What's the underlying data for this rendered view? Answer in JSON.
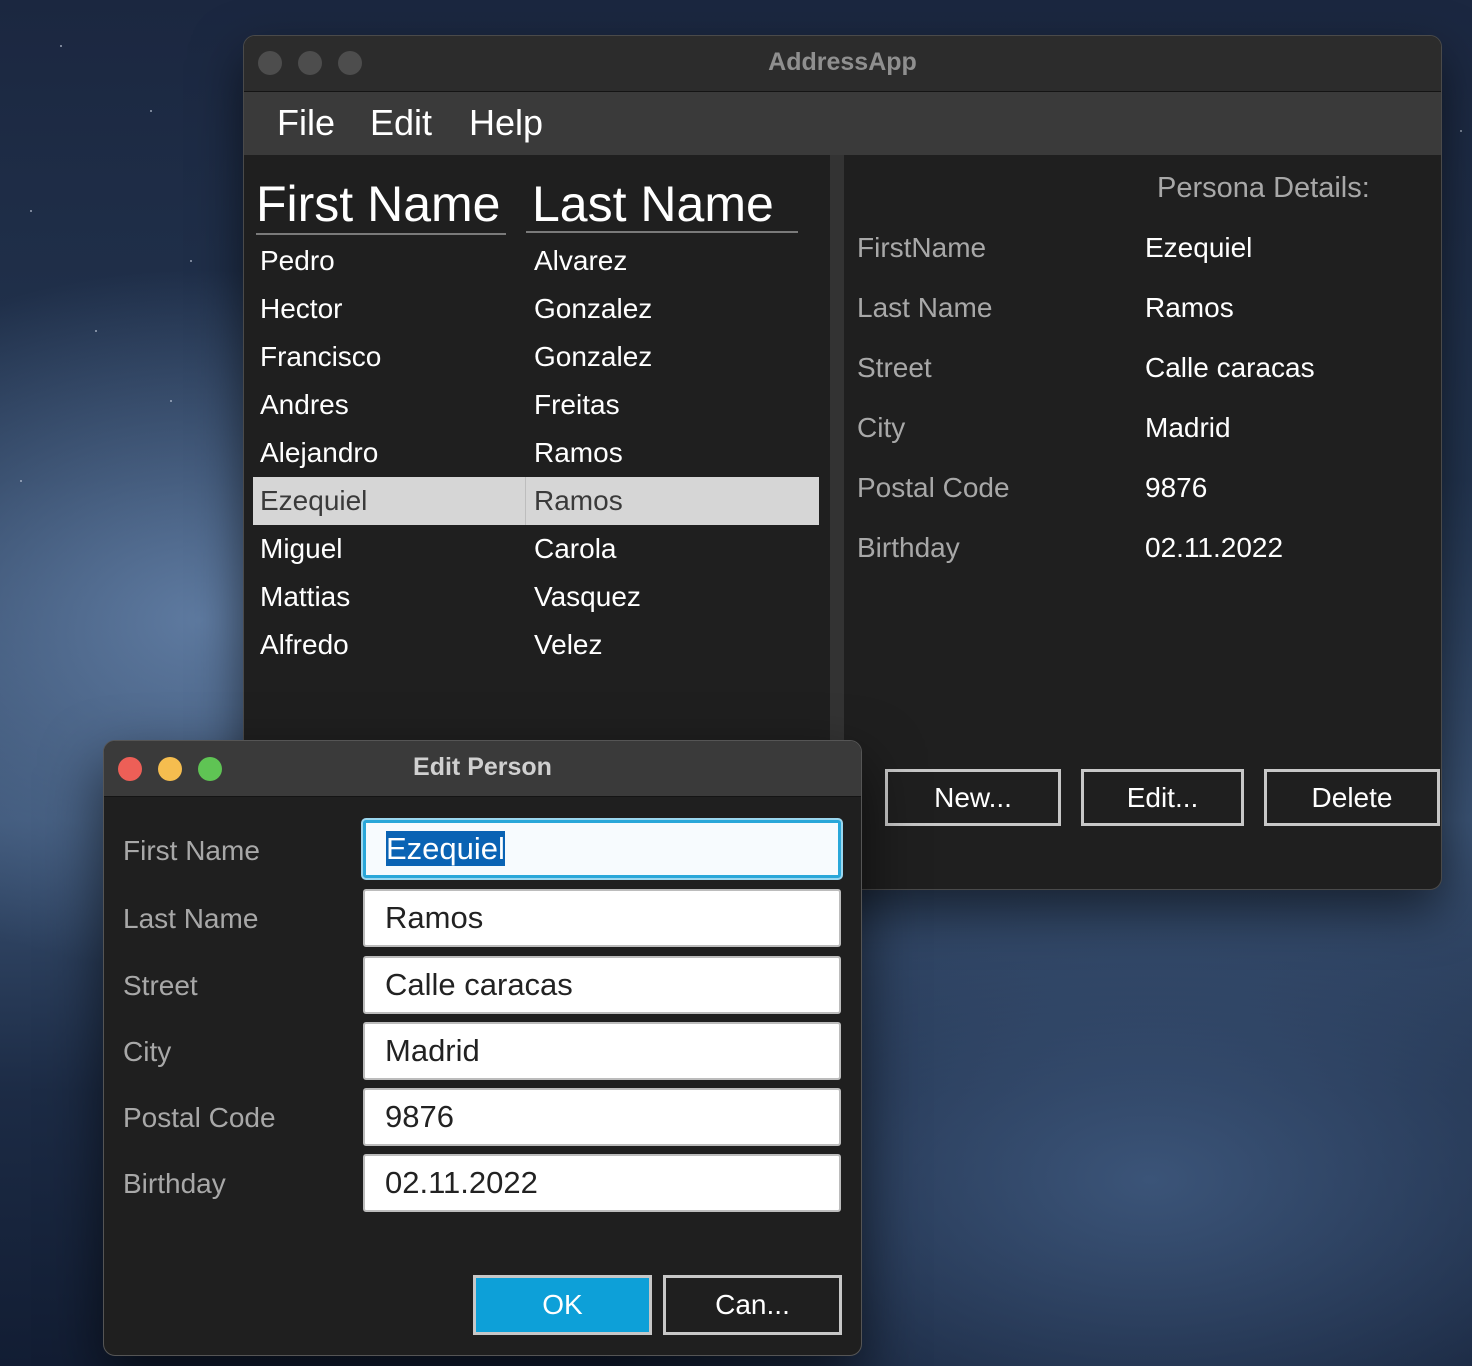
{
  "main_window": {
    "title": "AddressApp",
    "menu": [
      "File",
      "Edit",
      "Help"
    ],
    "table": {
      "columns": [
        "First Name",
        "Last Name"
      ],
      "rows": [
        [
          "Pedro",
          "Alvarez"
        ],
        [
          "Hector",
          "Gonzalez"
        ],
        [
          "Francisco",
          "Gonzalez"
        ],
        [
          "Andres",
          "Freitas"
        ],
        [
          "Alejandro",
          "Ramos"
        ],
        [
          "Ezequiel",
          "Ramos"
        ],
        [
          "Miguel",
          "Carola"
        ],
        [
          "Mattias",
          "Vasquez"
        ],
        [
          "Alfredo",
          "Velez"
        ]
      ],
      "selected_index": 5
    },
    "details": {
      "title": "Persona Details:",
      "fields": [
        {
          "label": "FirstName",
          "value": "Ezequiel"
        },
        {
          "label": "Last Name",
          "value": "Ramos"
        },
        {
          "label": "Street",
          "value": "Calle caracas"
        },
        {
          "label": "City",
          "value": "Madrid"
        },
        {
          "label": "Postal Code",
          "value": "9876"
        },
        {
          "label": "Birthday",
          "value": "02.11.2022"
        }
      ]
    },
    "buttons": {
      "new": "New...",
      "edit": "Edit...",
      "delete": "Delete"
    }
  },
  "dialog": {
    "title": "Edit Person",
    "fields": [
      {
        "label": "First Name",
        "value": "Ezequiel"
      },
      {
        "label": "Last Name",
        "value": "Ramos"
      },
      {
        "label": "Street",
        "value": "Calle caracas"
      },
      {
        "label": "City",
        "value": "Madrid"
      },
      {
        "label": "Postal Code",
        "value": "9876"
      },
      {
        "label": "Birthday",
        "value": "02.11.2022"
      }
    ],
    "ok_label": "OK",
    "cancel_label": "Can..."
  },
  "colors": {
    "accent": "#0da0d8",
    "selection": "#0a63b4",
    "traffic_close": "#ed5f57",
    "traffic_minimize": "#f5bd4f",
    "traffic_zoom": "#5fc454"
  }
}
